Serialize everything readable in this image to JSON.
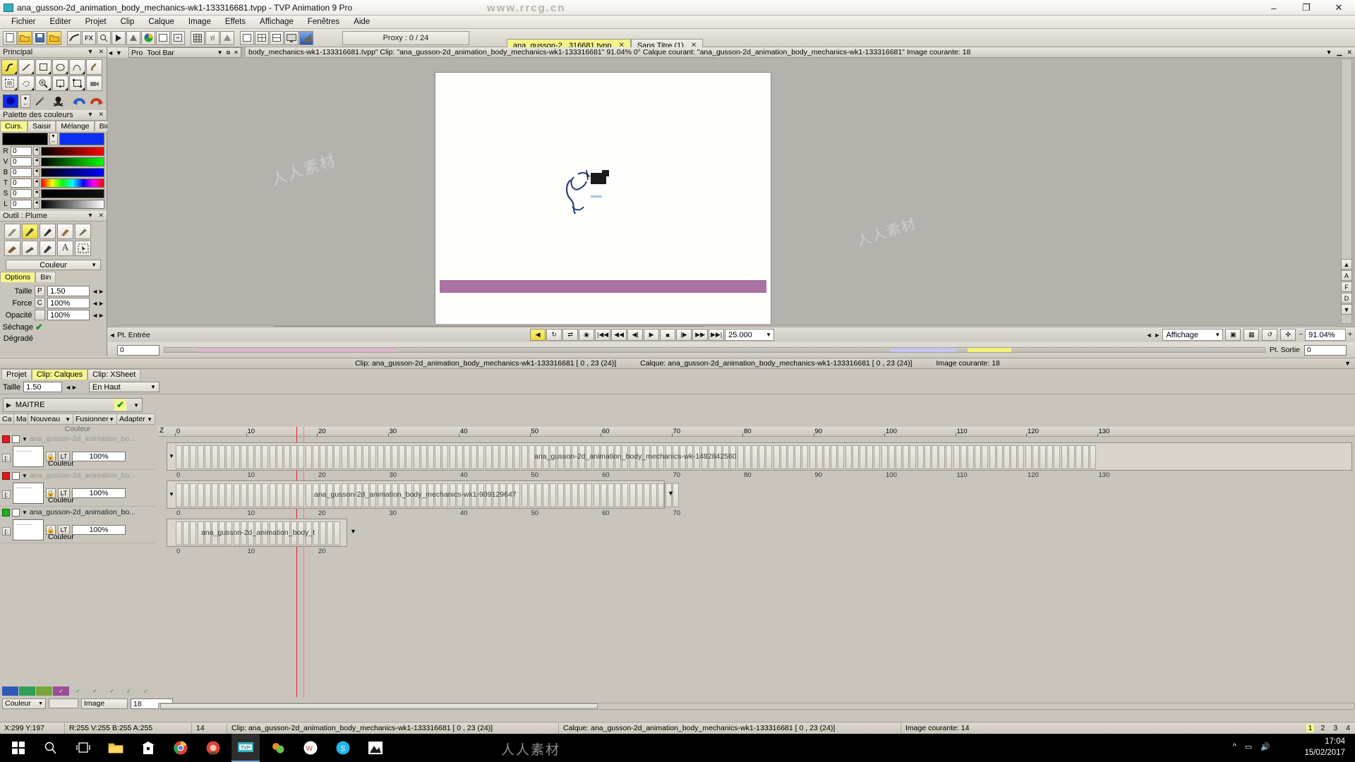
{
  "window": {
    "title": "ana_gusson-2d_animation_body_mechanics-wk1-133316681.tvpp - TVP Animation 9 Pro",
    "minimize": "–",
    "maximize": "❐",
    "close": "✕"
  },
  "menubar": {
    "items": [
      "Fichier",
      "Editer",
      "Projet",
      "Clip",
      "Calque",
      "Image",
      "Effets",
      "Affichage",
      "Fenêtres",
      "Aide"
    ]
  },
  "toolbar": {
    "proxy_label": "Proxy : 0 / 24"
  },
  "doc_tabs": [
    {
      "label": "ana_gusson-2...316681.tvpp",
      "close": "✕",
      "active": true
    },
    {
      "label": "Sans Titre (1)",
      "close": "✕",
      "active": false
    }
  ],
  "panels": {
    "principal": {
      "title": "Principal",
      "collapse": "▼",
      "close": "✕",
      "tools_row1": [
        "freehand-tool",
        "line-tool",
        "rect-tool",
        "ellipse-tool",
        "curve-tool",
        "warp-tool"
      ],
      "tools_row2": [
        "select-rect-tool",
        "lasso-tool",
        "zoom-tool",
        "crop-tool",
        "transform-tool",
        "camera-tool"
      ]
    },
    "colorbar": {
      "swatch_color": "#0f2ef0",
      "eyedropper": "eyedropper-icon",
      "skull": "skull-icon",
      "undo": "undo-icon",
      "redo": "redo-icon"
    },
    "palette": {
      "title": "Palette des couleurs",
      "collapse": "▼",
      "close": "✕",
      "tabs": [
        {
          "label": "Curs.",
          "active": true
        },
        {
          "label": "Saisir",
          "active": false
        },
        {
          "label": "Mélange",
          "active": false
        },
        {
          "label": "Bin",
          "active": false
        }
      ],
      "current_color": "#000000",
      "alt_color": "#0d2ff2",
      "sliders": [
        {
          "label": "R",
          "value": "0"
        },
        {
          "label": "V",
          "value": "0"
        },
        {
          "label": "B",
          "value": "0"
        },
        {
          "label": "T",
          "value": "0"
        },
        {
          "label": "S",
          "value": "0"
        },
        {
          "label": "L",
          "value": "0"
        }
      ]
    },
    "outil": {
      "title": "Outil : Plume",
      "collapse": "▼",
      "close": "✕",
      "brushes_row1": [
        "pen-soft-icon",
        "pen-nib-icon",
        "pen-fine-icon",
        "brush-icon",
        "pen-round-icon"
      ],
      "brushes_row2": [
        "marker-icon",
        "felt-icon",
        "ink-brush-icon",
        "text-tool-icon",
        "select-tool-icon"
      ],
      "mode_label": "Couleur",
      "tabs": [
        {
          "label": "Options",
          "active": true
        },
        {
          "label": "Bin",
          "active": false
        }
      ],
      "options": [
        {
          "label": "Taille",
          "button": "P",
          "value": "1.50"
        },
        {
          "label": "Force",
          "button": "C",
          "value": "100%"
        },
        {
          "label": "Opacité",
          "button": "",
          "value": "100%"
        }
      ],
      "sechage_label": "Séchage",
      "sechage_checked": "✔",
      "degrade_label": "Dégradé"
    }
  },
  "canvas": {
    "tool_bar_float": {
      "project_label": "Pro",
      "title": "Tool Bar",
      "collapse": "▼",
      "pin": "⧉",
      "close": "✕"
    },
    "clip_info": "body_mechanics-wk1-133316681.tvpp\"  Clip: \"ana_gusson-2d_animation_body_mechanics-wk1-133316681\"  91.04%   0°  Calque courant: \"ana_gusson-2d_animation_body_mechanics-wk1-133316681\"  Image courante: 18",
    "zoom_level": "91.04%",
    "display_label": "Affichage",
    "pt_entree": "Pt. Entrée",
    "pt_sortie": "Pt. Sortie",
    "entry_value": "0",
    "exit_value": "0",
    "fps": "25.000",
    "transport": [
      "loop-start-icon",
      "loop-icon",
      "pingpong-icon",
      "onion-skin-icon",
      "first-frame-icon",
      "rewind-icon",
      "prev-frame-icon",
      "play-icon",
      "stop-icon",
      "next-frame-icon",
      "forward-icon",
      "last-frame-icon"
    ],
    "side_buttons": [
      "A",
      "F",
      "D"
    ]
  },
  "mid_status": {
    "clip": "Clip: ana_gusson-2d_animation_body_mechanics-wk1-133316681 [ 0 , 23  (24)]",
    "calque": "Calque: ana_gusson-2d_animation_body_mechanics-wk1-133316681 [ 0 , 23  (24)]",
    "image": "Image courante: 18"
  },
  "timeline": {
    "tabs": [
      {
        "label": "Projet",
        "active": false
      },
      {
        "label": "Clip: Calques",
        "active": true
      },
      {
        "label": "Clip: XSheet",
        "active": false
      }
    ],
    "size_label": "Taille",
    "size_value": "1.50",
    "position_label": "En Haut",
    "master": {
      "label": "MAITRE",
      "triangle": "▶",
      "check": "✔",
      "arrow": "▼"
    },
    "columns": [
      "Ca",
      "Ma",
      "Nouveau",
      "Fusionner",
      "Adapter"
    ],
    "column_sub": "Couleur",
    "layers": [
      {
        "name": "ana_gusson-2d_animation_bo...",
        "dot_color": "#e01b1b",
        "opacity": "100%",
        "blend": "Couleur",
        "lt": "LT",
        "track_label": "ana_gusson-2d_animation_body_mechanics-wk-1482842560",
        "frames": 128
      },
      {
        "name": "ana_gusson-2d_animation_bo...",
        "dot_color": "#e01b1b",
        "opacity": "100%",
        "blend": "Couleur",
        "lt": "LT",
        "track_label": "ana_gusson-2d_animation_body_mechanics-wk1-909129647",
        "frames": 70
      },
      {
        "name": "ana_gusson-2d_animation_bo...",
        "dot_color": "#1fb01f",
        "opacity": "100%",
        "blend": "Couleur",
        "lt": "LT",
        "track_label": "ana_gusson-2d_animation_body_t",
        "frames": 23
      }
    ],
    "ruler_major": [
      0,
      10,
      20,
      30,
      40,
      50,
      60,
      70,
      80,
      90,
      100,
      110,
      120,
      130
    ],
    "bottom": {
      "couleur_label": "Couleur",
      "image_label": "Image",
      "image_value": "18"
    }
  },
  "statusbar": {
    "coords": "X:299  Y:197",
    "rgba": "R:255 V:255 B:255 A:255",
    "frame": "14",
    "clip": "Clip: ana_gusson-2d_animation_body_mechanics-wk1-133316681 [ 0 , 23  (24)]",
    "calque": "Calque: ana_gusson-2d_animation_body_mechanics-wk1-133316681 [ 0 , 23  (24)]",
    "image": "Image courante: 14",
    "pages": [
      "1",
      "2",
      "3",
      "4"
    ],
    "page_active": "1"
  },
  "taskbar": {
    "items": [
      "windows-start-icon",
      "search-icon",
      "task-view-icon",
      "file-explorer-icon",
      "microsoft-store-icon",
      "chrome-icon",
      "chrome-profile-icon",
      "tvp-animation-icon",
      "media-icon",
      "wps-icon",
      "skype-icon",
      "photos-icon"
    ],
    "clock_time": "17:04",
    "clock_date": "15/02/2017"
  },
  "watermark": {
    "top": "www.rrcg.cn",
    "bottom": "人人素材"
  }
}
